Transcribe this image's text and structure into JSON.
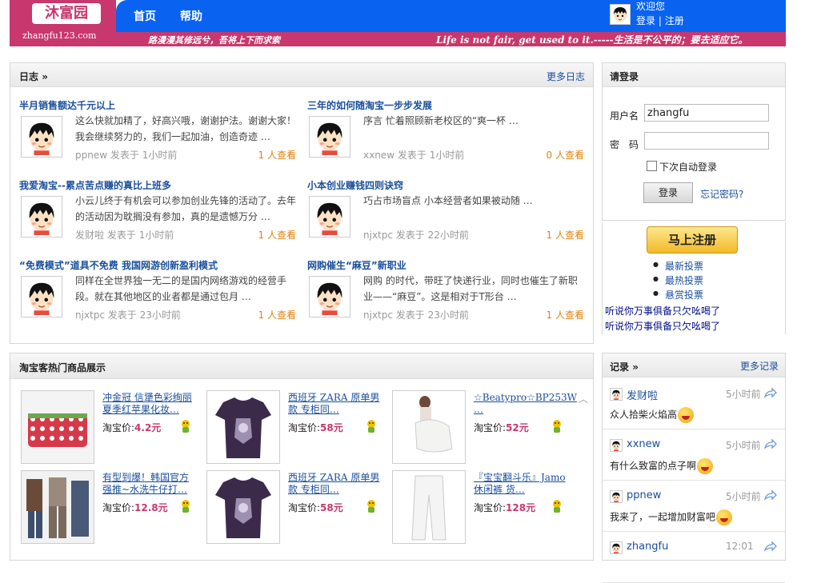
{
  "header": {
    "logo_text": "沐富园",
    "logo_url": "zhangfu123.com",
    "nav": [
      "首页",
      "帮助"
    ],
    "welcome": "欢迎您",
    "login_link": "登录",
    "separator": "|",
    "register_link": "注册",
    "slogan_left": "路漫漫其修远兮，吾将上下而求索",
    "slogan_right": "Life is not fair, get used to it.-----生活是不公平的；要去适应它。"
  },
  "blog": {
    "title": "日志",
    "arrow": "»",
    "more": "更多日志",
    "posts": [
      {
        "title": "半月销售额达千元以上",
        "excerpt": "这么快就加精了，好高兴哦，谢谢护法。谢谢大家！我会继续努力的，我们一起加油，创造奇迹 …",
        "author": "ppnew",
        "posted": "发表于",
        "time": "1小时前",
        "views": "1 人查看"
      },
      {
        "title": "三年的如何随淘宝一步步发展",
        "excerpt": "序言          忙着照顾新老校区的“爽一杯 …",
        "author": "xxnew",
        "posted": "发表于",
        "time": "1小时前",
        "views": "0 人查看"
      },
      {
        "title": "我爱淘宝--累点苦点赚的真比上班多",
        "excerpt": "小云儿终于有机会可以参加创业先锋的活动了。去年的活动因为耽搁没有参加，真的是遗憾万分 …",
        "author": "发财啦",
        "posted": "发表于",
        "time": "1小时前",
        "views": "1 人查看"
      },
      {
        "title": "小本创业赚钱四则诀窍",
        "excerpt": "巧占市场盲点          小本经营者如果被动随 …",
        "author": "njxtpc",
        "posted": "发表于",
        "time": "22小时前",
        "views": "1 人查看"
      },
      {
        "title": "“免费模式”道具不免费  我国网游创新盈利模式",
        "excerpt": "      同样在全世界独一无二的是国内网络游戏的经营手段。就在其他地区的业者都是通过包月 …",
        "author": "njxtpc",
        "posted": "发表于",
        "time": "23小时前",
        "views": "1 人查看"
      },
      {
        "title": "网购催生“麻豆”新职业",
        "excerpt": "      网购 的时代，带旺了快递行业，同时也催生了新职业——“麻豆”。这是相对于T形台 …",
        "author": "njxtpc",
        "posted": "发表于",
        "time": "23小时前",
        "views": "1 人查看"
      }
    ]
  },
  "login": {
    "title": "请登录",
    "username_label": "用户名",
    "username_value": "zhangfu",
    "password_label": "密　码",
    "remember_label": "下次自动登录",
    "login_button": "登录",
    "forgot_link": "忘记密码?"
  },
  "sidebar": {
    "register_button": "马上注册",
    "votes": [
      "最新投票",
      "最热投票",
      "悬赏投票"
    ],
    "marquee": [
      "听说你万事俱备只欠吆喝了",
      "听说你万事俱备只欠吆喝了"
    ]
  },
  "taobao": {
    "title": "淘宝客热门商品展示",
    "price_label": "淘宝价:",
    "scroll_up": "^",
    "products": [
      {
        "name": "冲金冠 信犟色彩绚丽夏季红苹果化妆…",
        "price": "4.2元",
        "image": "red-strawberry-bag"
      },
      {
        "name": "西班牙 ZARA 原单男款 专柜同…",
        "price": "58元",
        "image": "purple-tshirt"
      },
      {
        "name": "☆Beatypro☆BP253W …",
        "price": "52元",
        "image": "white-handbag"
      },
      {
        "name": "有型到爆！韩国官方强推~水洗牛仔打…",
        "price": "12.8元",
        "image": "denim-outfits"
      },
      {
        "name": "西班牙 ZARA 原单男款 专柜同…",
        "price": "58元",
        "image": "purple-tshirt"
      },
      {
        "name": "『宝宝翻斗乐』Jamo休闲裤 货…",
        "price": "128元",
        "image": "white-trousers"
      }
    ]
  },
  "records": {
    "title": "记录",
    "arrow": "»",
    "more": "更多记录",
    "items": [
      {
        "name": "发财啦",
        "time": "5小时前",
        "text": "众人拾柴火焰高",
        "emoji": "laugh-emoji"
      },
      {
        "name": "xxnew",
        "time": "5小时前",
        "text": "有什么致富的点子啊",
        "emoji": "angry-emoji"
      },
      {
        "name": "ppnew",
        "time": "5小时前",
        "text": "我来了，一起增加财富吧",
        "emoji": "grin-emoji"
      },
      {
        "name": "zhangfu",
        "time": "12:01",
        "text": "",
        "emoji": ""
      }
    ]
  },
  "colors": {
    "brand_pink": "#c8376e",
    "nav_blue": "#0a63f0",
    "link_blue": "#1a4f9c",
    "views_orange": "#e3820e"
  }
}
